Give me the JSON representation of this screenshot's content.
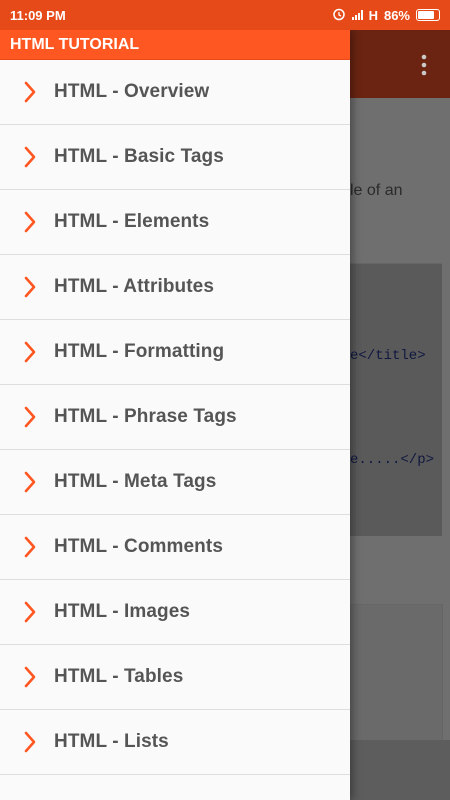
{
  "status_bar": {
    "time": "11:09 PM",
    "network": "H",
    "battery": "86%",
    "icons": [
      "alarm-icon",
      "signal-icon",
      "battery-icon"
    ]
  },
  "drawer": {
    "title": "HTML TUTORIAL",
    "items": [
      {
        "label": "HTML - Overview"
      },
      {
        "label": "HTML - Basic Tags"
      },
      {
        "label": "HTML - Elements"
      },
      {
        "label": "HTML - Attributes"
      },
      {
        "label": "HTML - Formatting"
      },
      {
        "label": "HTML - Phrase Tags"
      },
      {
        "label": "HTML - Meta Tags"
      },
      {
        "label": "HTML - Comments"
      },
      {
        "label": "HTML - Images"
      },
      {
        "label": "HTML - Tables"
      },
      {
        "label": "HTML - Lists"
      }
    ],
    "item_icon": "chevron-right-icon"
  },
  "background": {
    "text_fragment": "le of an",
    "code_line_1": "e</title>",
    "code_line_2": "e.....</p>",
    "overflow_icon": "more-vert-icon"
  },
  "colors": {
    "accent": "#ff5722",
    "status_bar": "#e64a19",
    "chevron": "#ff5722"
  }
}
